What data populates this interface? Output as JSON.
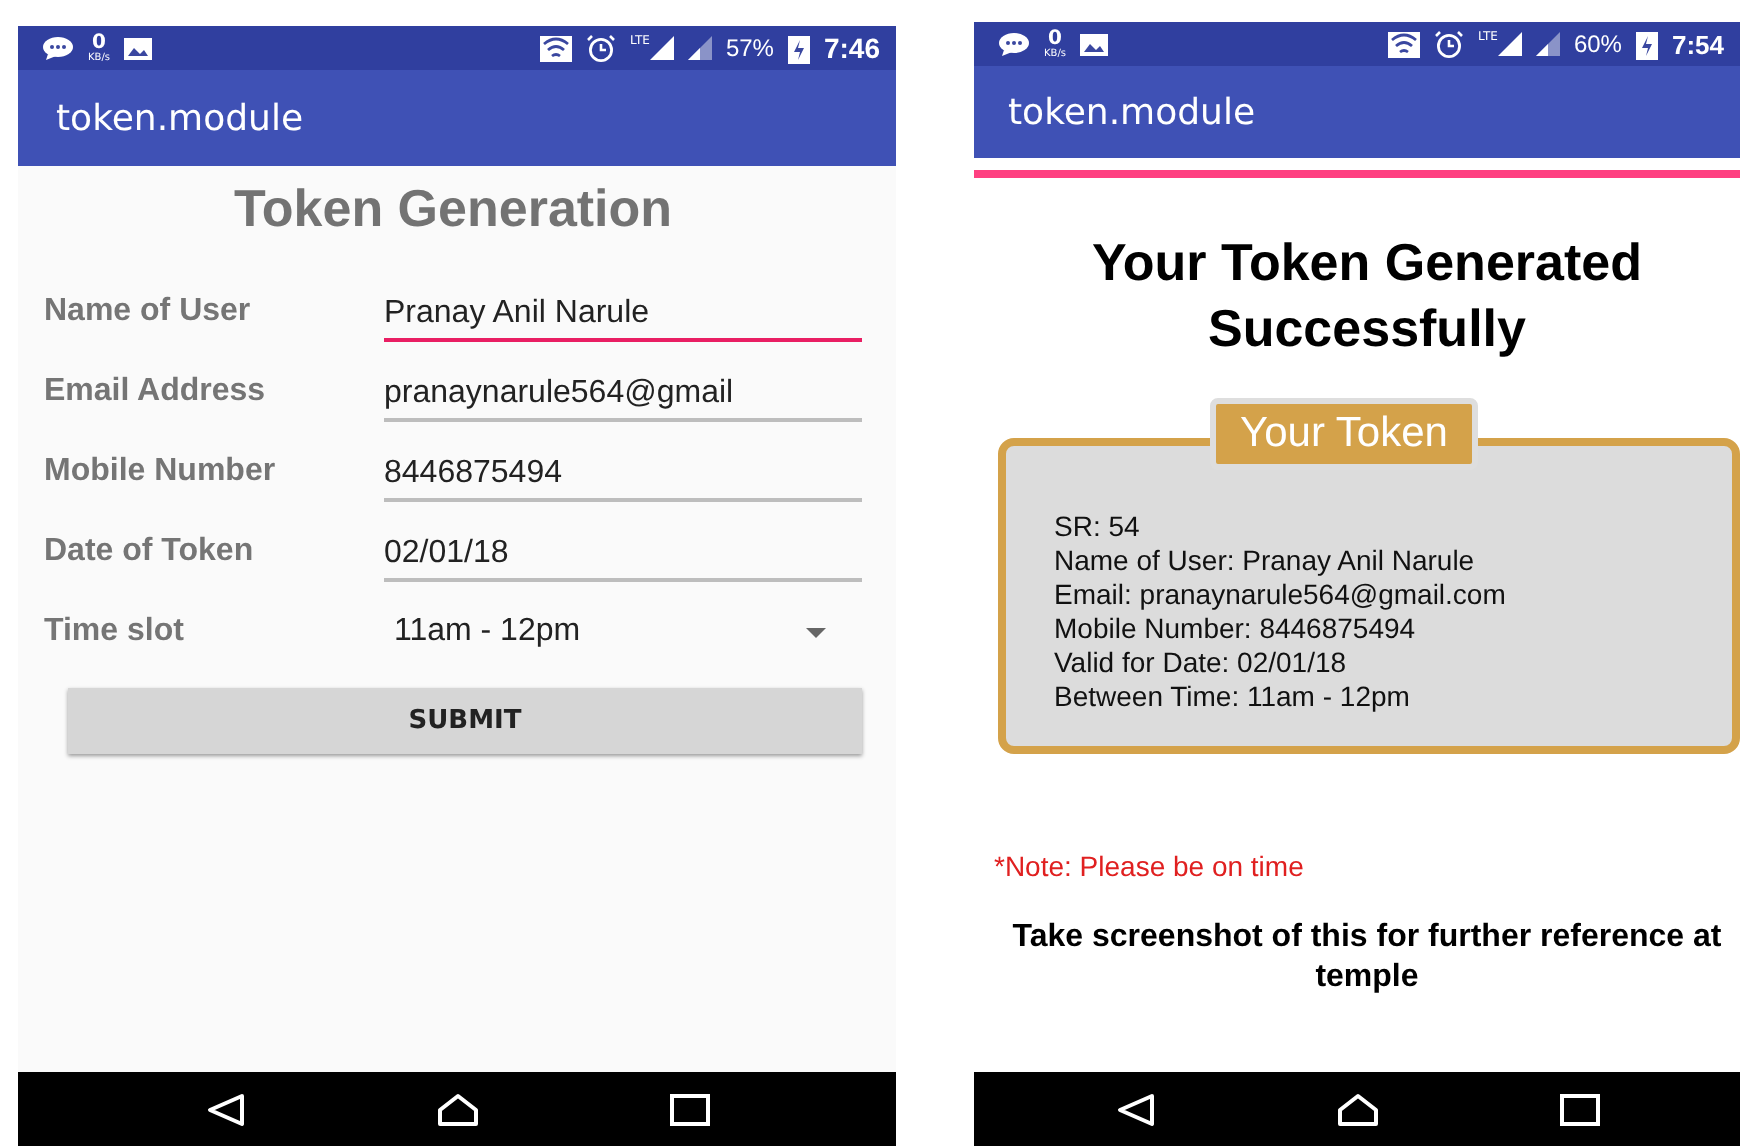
{
  "screens": [
    {
      "kind": "form",
      "status_bar": {
        "speed": "0",
        "speed_unit": "KB/s",
        "network": "LTE",
        "battery": "57%",
        "time": "7:46"
      },
      "app_bar": {
        "title": "token.module"
      },
      "heading": "Token Generation",
      "fields": [
        {
          "label": "Name of User",
          "value": "Pranay Anil Narule",
          "focused": true
        },
        {
          "label": "Email Address",
          "value": "pranaynarule564@gmail",
          "focused": false
        },
        {
          "label": "Mobile Number",
          "value": "8446875494",
          "focused": false
        },
        {
          "label": "Date of Token",
          "value": "02/01/18",
          "focused": false
        }
      ],
      "dropdown": {
        "label": "Time slot",
        "value": "11am - 12pm"
      },
      "submit_button": "SUBMIT"
    },
    {
      "kind": "result",
      "status_bar": {
        "speed": "0",
        "speed_unit": "KB/s",
        "network": "LTE",
        "battery": "60%",
        "time": "7:54"
      },
      "app_bar": {
        "title": "token.module"
      },
      "heading": "Your Token Generated Successfully",
      "token_card": {
        "title": "Your Token",
        "lines": [
          "SR: 54",
          "Name of User: Pranay Anil Narule",
          "Email: pranaynarule564@gmail.com",
          "Mobile Number: 8446875494",
          "Valid for Date: 02/01/18",
          "Between Time: 11am - 12pm"
        ]
      },
      "note": "*Note: Please be on time",
      "instruction": "Take screenshot of this for further reference at temple"
    }
  ]
}
